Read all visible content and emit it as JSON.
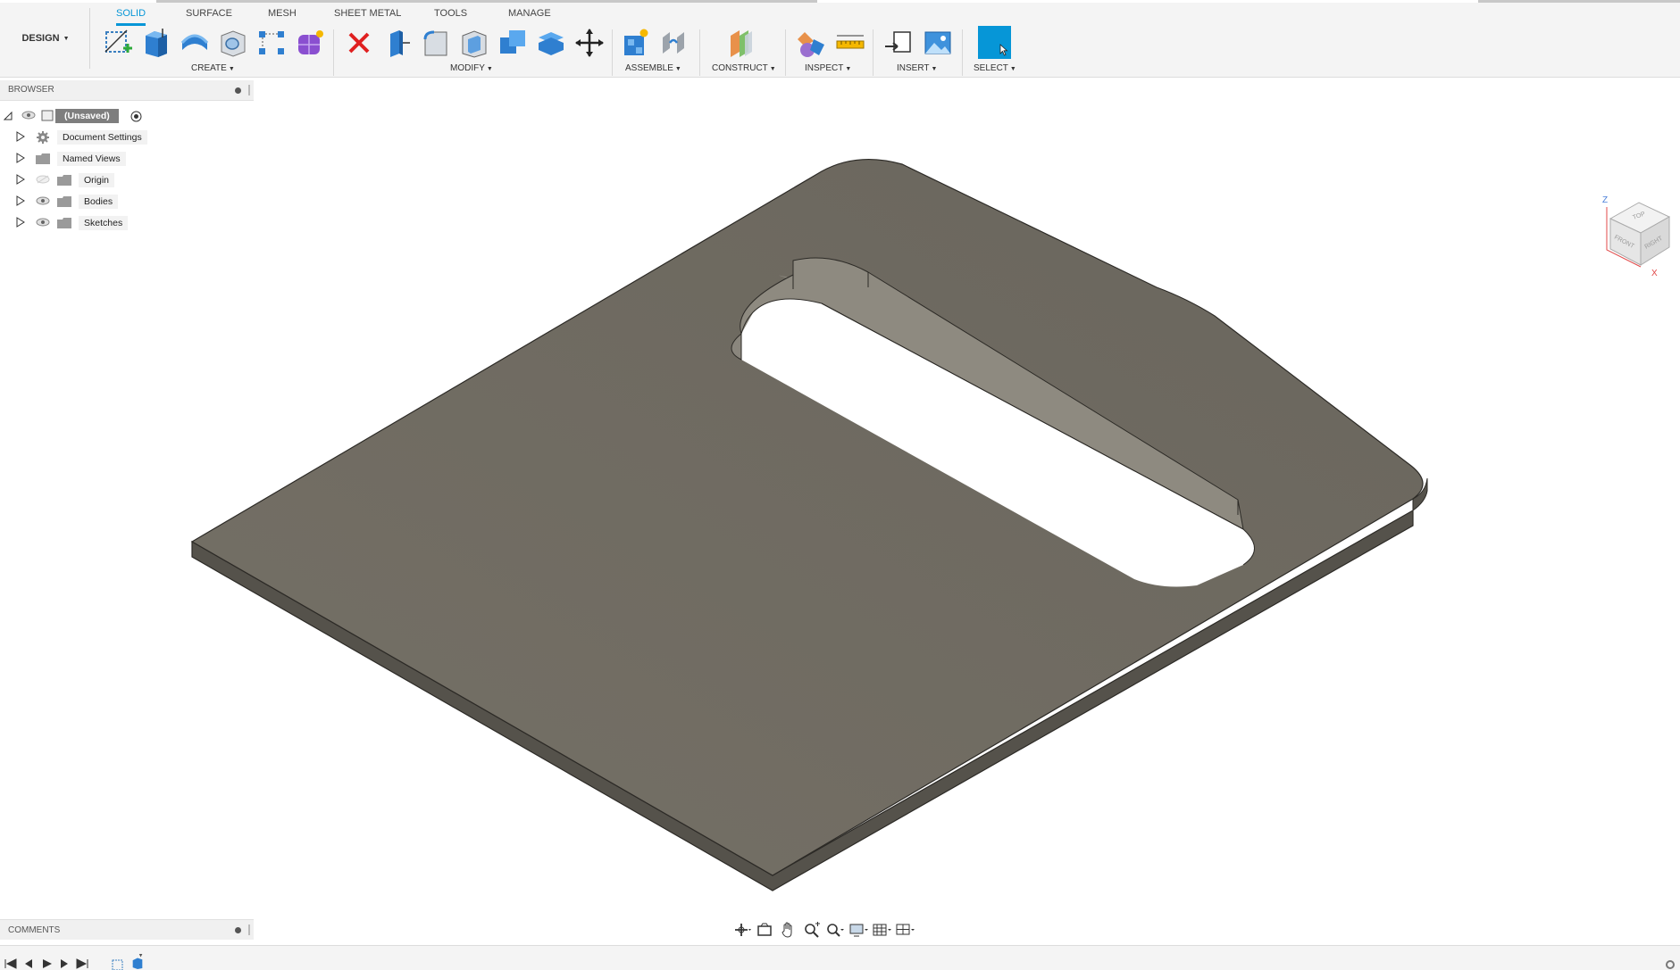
{
  "workspace": {
    "label": "DESIGN"
  },
  "tabs": [
    {
      "label": "SOLID",
      "active": true
    },
    {
      "label": "SURFACE",
      "active": false
    },
    {
      "label": "MESH",
      "active": false
    },
    {
      "label": "SHEET METAL",
      "active": false
    },
    {
      "label": "TOOLS",
      "active": false
    },
    {
      "label": "MANAGE",
      "active": false
    }
  ],
  "groups": {
    "create": "CREATE",
    "modify": "MODIFY",
    "assemble": "ASSEMBLE",
    "construct": "CONSTRUCT",
    "inspect": "INSPECT",
    "insert": "INSERT",
    "select": "SELECT"
  },
  "tool_icons": {
    "create": [
      "create-sketch-icon",
      "extrude-icon",
      "revolve-icon",
      "hole-icon",
      "pattern-icon",
      "create-form-icon"
    ],
    "modify": [
      "delete-icon",
      "press-pull-icon",
      "fillet-icon",
      "shell-icon",
      "combine-icon",
      "offset-face-icon",
      "move-icon"
    ],
    "assemble": [
      "new-component-icon",
      "joint-icon"
    ],
    "construct": [
      "offset-plane-icon"
    ],
    "inspect": [
      "interference-icon",
      "measure-icon"
    ],
    "insert": [
      "insert-derive-icon",
      "insert-image-icon"
    ],
    "select": [
      "select-icon"
    ]
  },
  "browser": {
    "title": "BROWSER",
    "root": "(Unsaved)",
    "items": [
      {
        "label": "Document Settings",
        "icon": "gear-icon"
      },
      {
        "label": "Named Views",
        "icon": "folder-icon"
      },
      {
        "label": "Origin",
        "icon": "folder-icon",
        "hidden": true
      },
      {
        "label": "Bodies",
        "icon": "folder-icon"
      },
      {
        "label": "Sketches",
        "icon": "folder-icon"
      }
    ]
  },
  "viewcube": {
    "top": "TOP",
    "front": "FRONT",
    "right": "RIGHT",
    "axis_z": "Z",
    "axis_x": "X"
  },
  "comments": {
    "title": "COMMENTS"
  },
  "colors": {
    "accent": "#0696d7",
    "body_top": "#706c63",
    "body_edge": "#55524b",
    "hole_wall": "#8a867d",
    "toolbar_bg": "#f4f4f4"
  }
}
